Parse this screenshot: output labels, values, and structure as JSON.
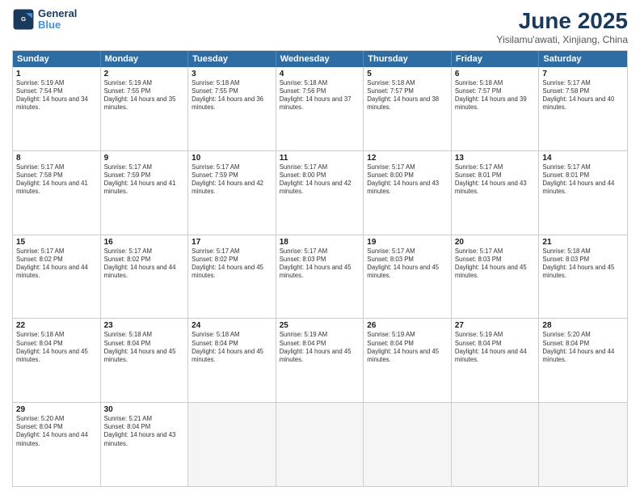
{
  "logo": {
    "line1": "General",
    "line2": "Blue"
  },
  "title": "June 2025",
  "location": "Yisilamu'awati, Xinjiang, China",
  "weekdays": [
    "Sunday",
    "Monday",
    "Tuesday",
    "Wednesday",
    "Thursday",
    "Friday",
    "Saturday"
  ],
  "rows": [
    [
      {
        "day": "1",
        "sunrise": "5:19 AM",
        "sunset": "7:54 PM",
        "daylight": "14 hours and 34 minutes."
      },
      {
        "day": "2",
        "sunrise": "5:19 AM",
        "sunset": "7:55 PM",
        "daylight": "14 hours and 35 minutes."
      },
      {
        "day": "3",
        "sunrise": "5:18 AM",
        "sunset": "7:55 PM",
        "daylight": "14 hours and 36 minutes."
      },
      {
        "day": "4",
        "sunrise": "5:18 AM",
        "sunset": "7:56 PM",
        "daylight": "14 hours and 37 minutes."
      },
      {
        "day": "5",
        "sunrise": "5:18 AM",
        "sunset": "7:57 PM",
        "daylight": "14 hours and 38 minutes."
      },
      {
        "day": "6",
        "sunrise": "5:18 AM",
        "sunset": "7:57 PM",
        "daylight": "14 hours and 39 minutes."
      },
      {
        "day": "7",
        "sunrise": "5:17 AM",
        "sunset": "7:58 PM",
        "daylight": "14 hours and 40 minutes."
      }
    ],
    [
      {
        "day": "8",
        "sunrise": "5:17 AM",
        "sunset": "7:58 PM",
        "daylight": "14 hours and 41 minutes."
      },
      {
        "day": "9",
        "sunrise": "5:17 AM",
        "sunset": "7:59 PM",
        "daylight": "14 hours and 41 minutes."
      },
      {
        "day": "10",
        "sunrise": "5:17 AM",
        "sunset": "7:59 PM",
        "daylight": "14 hours and 42 minutes."
      },
      {
        "day": "11",
        "sunrise": "5:17 AM",
        "sunset": "8:00 PM",
        "daylight": "14 hours and 42 minutes."
      },
      {
        "day": "12",
        "sunrise": "5:17 AM",
        "sunset": "8:00 PM",
        "daylight": "14 hours and 43 minutes."
      },
      {
        "day": "13",
        "sunrise": "5:17 AM",
        "sunset": "8:01 PM",
        "daylight": "14 hours and 43 minutes."
      },
      {
        "day": "14",
        "sunrise": "5:17 AM",
        "sunset": "8:01 PM",
        "daylight": "14 hours and 44 minutes."
      }
    ],
    [
      {
        "day": "15",
        "sunrise": "5:17 AM",
        "sunset": "8:02 PM",
        "daylight": "14 hours and 44 minutes."
      },
      {
        "day": "16",
        "sunrise": "5:17 AM",
        "sunset": "8:02 PM",
        "daylight": "14 hours and 44 minutes."
      },
      {
        "day": "17",
        "sunrise": "5:17 AM",
        "sunset": "8:02 PM",
        "daylight": "14 hours and 45 minutes."
      },
      {
        "day": "18",
        "sunrise": "5:17 AM",
        "sunset": "8:03 PM",
        "daylight": "14 hours and 45 minutes."
      },
      {
        "day": "19",
        "sunrise": "5:17 AM",
        "sunset": "8:03 PM",
        "daylight": "14 hours and 45 minutes."
      },
      {
        "day": "20",
        "sunrise": "5:17 AM",
        "sunset": "8:03 PM",
        "daylight": "14 hours and 45 minutes."
      },
      {
        "day": "21",
        "sunrise": "5:18 AM",
        "sunset": "8:03 PM",
        "daylight": "14 hours and 45 minutes."
      }
    ],
    [
      {
        "day": "22",
        "sunrise": "5:18 AM",
        "sunset": "8:04 PM",
        "daylight": "14 hours and 45 minutes."
      },
      {
        "day": "23",
        "sunrise": "5:18 AM",
        "sunset": "8:04 PM",
        "daylight": "14 hours and 45 minutes."
      },
      {
        "day": "24",
        "sunrise": "5:18 AM",
        "sunset": "8:04 PM",
        "daylight": "14 hours and 45 minutes."
      },
      {
        "day": "25",
        "sunrise": "5:19 AM",
        "sunset": "8:04 PM",
        "daylight": "14 hours and 45 minutes."
      },
      {
        "day": "26",
        "sunrise": "5:19 AM",
        "sunset": "8:04 PM",
        "daylight": "14 hours and 45 minutes."
      },
      {
        "day": "27",
        "sunrise": "5:19 AM",
        "sunset": "8:04 PM",
        "daylight": "14 hours and 44 minutes."
      },
      {
        "day": "28",
        "sunrise": "5:20 AM",
        "sunset": "8:04 PM",
        "daylight": "14 hours and 44 minutes."
      }
    ],
    [
      {
        "day": "29",
        "sunrise": "5:20 AM",
        "sunset": "8:04 PM",
        "daylight": "14 hours and 44 minutes."
      },
      {
        "day": "30",
        "sunrise": "5:21 AM",
        "sunset": "8:04 PM",
        "daylight": "14 hours and 43 minutes."
      },
      null,
      null,
      null,
      null,
      null
    ]
  ]
}
